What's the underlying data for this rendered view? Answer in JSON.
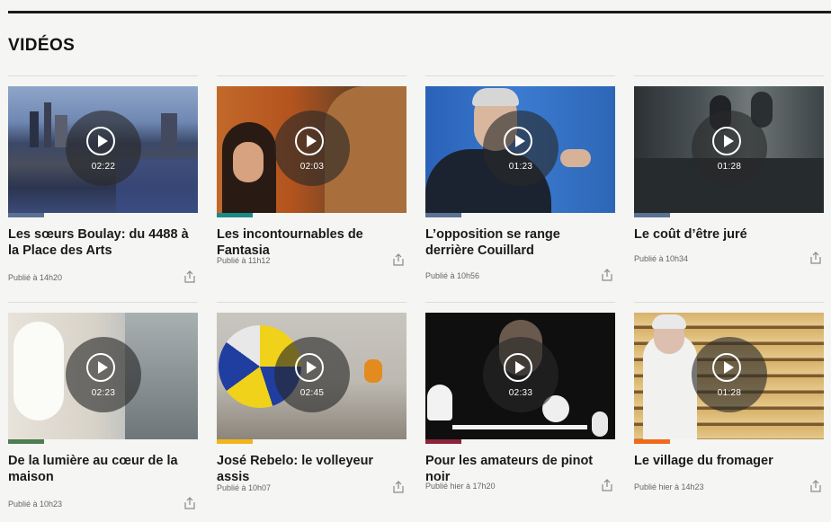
{
  "section": {
    "title": "VIDÉOS"
  },
  "videos": [
    {
      "title": "Les sœurs Boulay: du 4488 à la Place des Arts",
      "duration": "02:22",
      "published": "Publié à 14h20",
      "category_color": "#5a7191"
    },
    {
      "title": "Les incontournables de Fantasia",
      "duration": "02:03",
      "published": "Publié à 11h12",
      "category_color": "#1a8a87"
    },
    {
      "title": "L’opposition se range derrière Couillard",
      "duration": "01:23",
      "published": "Publié à 10h56",
      "category_color": "#5a7191"
    },
    {
      "title": "Le coût d’être juré",
      "duration": "01:28",
      "published": "Publié à 10h34",
      "category_color": "#5a7191"
    },
    {
      "title": "De la lumière au cœur de la maison",
      "duration": "02:23",
      "published": "Publié à 10h23",
      "category_color": "#4d7e52"
    },
    {
      "title": "José Rebelo: le volleyeur assis",
      "duration": "02:45",
      "published": "Publié à 10h07",
      "category_color": "#f2b41b"
    },
    {
      "title": "Pour les amateurs de pinot noir",
      "duration": "02:33",
      "published": "Publié hier à 17h20",
      "category_color": "#8b2339"
    },
    {
      "title": "Le village du fromager",
      "duration": "01:28",
      "published": "Publié hier à 14h23",
      "category_color": "#ef6a1a"
    }
  ],
  "icons": {
    "play": "play-circle-icon",
    "share": "share-icon"
  }
}
